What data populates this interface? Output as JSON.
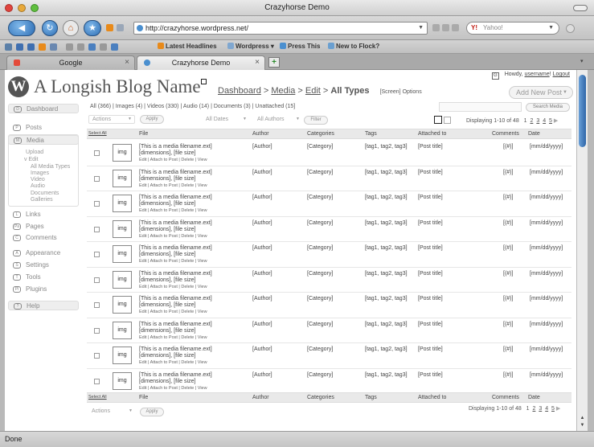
{
  "window": {
    "title": "Crazyhorse Demo"
  },
  "browser": {
    "url": "http://crazyhorse.wordpress.net/",
    "search_engine": "Yahoo!",
    "bookmarks": [
      "Latest Headlines",
      "Wordpress",
      "Press This",
      "New to Flock?"
    ],
    "tabs": [
      {
        "label": "Google",
        "close": "×"
      },
      {
        "label": "Crazyhorse Demo",
        "close": "×"
      }
    ],
    "new_tab": "+",
    "status": "Done",
    "scroll_arrows": "▲ ▼"
  },
  "header": {
    "logo": "W",
    "blog_name": "A Longish Blog Name",
    "crumb_dashboard": "Dashboard",
    "crumb_media": "Media",
    "crumb_edit": "Edit",
    "crumb_current": "All Types",
    "screen_options": "[Screen] Options",
    "howdy_icon": "G",
    "howdy_prefix": "Howdy,",
    "username": "username",
    "howdy_suffix": "!",
    "logout": "Logout",
    "add_new": "Add New Post",
    "add_new_arrow": "▼"
  },
  "sidebar": {
    "items": [
      {
        "icon": "D",
        "label": "Dashboard"
      },
      {
        "icon": "P",
        "label": "Posts"
      },
      {
        "icon": "M",
        "label": "Media"
      },
      {
        "icon": "L",
        "label": "Links"
      },
      {
        "icon": "Pa",
        "label": "Pages"
      },
      {
        "icon": "C",
        "label": "Comments"
      },
      {
        "icon": "A",
        "label": "Appearance"
      },
      {
        "icon": "S",
        "label": "Settings"
      },
      {
        "icon": "T",
        "label": "Tools"
      },
      {
        "icon": "Pl",
        "label": "Plugins"
      },
      {
        "icon": "?",
        "label": "Help"
      }
    ],
    "media_sub": {
      "upload": "Upload",
      "edit": "v Edit",
      "types": [
        "All Media Types",
        "Images",
        "Video",
        "Audio",
        "Documents",
        "Galleries"
      ]
    }
  },
  "toolbar": {
    "filters": "All (366)  |  Images (4)  |  Videos (330)  |  Audio (14)  |  Documents (3)  |  Unattached (15]",
    "search_button": "Search Media",
    "actions": "Actions",
    "apply": "Apply",
    "dates": "All Dates",
    "authors": "All Authors",
    "filter": "Filter",
    "arrow": "▼",
    "displaying": "Displaying 1-10 of 48",
    "pages": [
      "1",
      "2",
      "3",
      "4",
      "5"
    ],
    "next": "▶"
  },
  "table": {
    "columns": {
      "select_all": "Select All",
      "file": "File",
      "author": "Author",
      "categories": "Categories",
      "tags": "Tags",
      "attached": "Attached to",
      "comments": "Comments",
      "date": "Date"
    },
    "rows": [
      {
        "thumb": "img",
        "name": "[This is a media filename.ext]",
        "dims": "[dimensions], [file size]",
        "actions": "Edit | Attach to Post | Delete  | View",
        "author": "[Author]",
        "category": "[Category]",
        "tags": "[tag1, tag2, tag3]",
        "attached": "[Post title]",
        "comments": "[(#)]",
        "date": "[mm/dd/yyyy]"
      },
      {
        "thumb": "img",
        "name": "[This is a media filename.ext]",
        "dims": "[dimensions], [file size]",
        "actions": "Edit | Attach to Post | Delete  | View",
        "author": "[Author]",
        "category": "[Category]",
        "tags": "[tag1, tag2, tag3]",
        "attached": "[Post title]",
        "comments": "[(#)]",
        "date": "[mm/dd/yyyy]"
      },
      {
        "thumb": "img",
        "name": "[This is a media filename.ext]",
        "dims": "[dimensions], [file size]",
        "actions": "Edit | Attach to Post | Delete  | View",
        "author": "[Author]",
        "category": "[Category]",
        "tags": "[tag1, tag2, tag3]",
        "attached": "[Post title]",
        "comments": "[(#)]",
        "date": "[mm/dd/yyyy]"
      },
      {
        "thumb": "img",
        "name": "[This is a media filename.ext]",
        "dims": "[dimensions], [file size]",
        "actions": "Edit | Attach to Post | Delete  | View",
        "author": "[Author]",
        "category": "[Category]",
        "tags": "[tag1, tag2, tag3]",
        "attached": "[Post title]",
        "comments": "[(#)]",
        "date": "[mm/dd/yyyy]"
      },
      {
        "thumb": "img",
        "name": "[This is a media filename.ext]",
        "dims": "[dimensions], [file size]",
        "actions": "Edit | Attach to Post | Delete  | View",
        "author": "[Author]",
        "category": "[Category]",
        "tags": "[tag1, tag2, tag3]",
        "attached": "[Post title]",
        "comments": "[(#)]",
        "date": "[mm/dd/yyyy]"
      },
      {
        "thumb": "img",
        "name": "[This is a media filename.ext]",
        "dims": "[dimensions], [file size]",
        "actions": "Edit | Attach to Post | Delete  | View",
        "author": "[Author]",
        "category": "[Category]",
        "tags": "[tag1, tag2, tag3]",
        "attached": "[Post title]",
        "comments": "[(#)]",
        "date": "[mm/dd/yyyy]"
      },
      {
        "thumb": "img",
        "name": "[This is a media filename.ext]",
        "dims": "[dimensions], [file size]",
        "actions": "Edit | Attach to Post | Delete  | View",
        "author": "[Author]",
        "category": "[Category]",
        "tags": "[tag1, tag2, tag3]",
        "attached": "[Post title]",
        "comments": "[(#)]",
        "date": "[mm/dd/yyyy]"
      },
      {
        "thumb": "img",
        "name": "[This is a media filename.ext]",
        "dims": "[dimensions], [file size]",
        "actions": "Edit | Attach to Post | Delete  | View",
        "author": "[Author]",
        "category": "[Category]",
        "tags": "[tag1, tag2, tag3]",
        "attached": "[Post title]",
        "comments": "[(#)]",
        "date": "[mm/dd/yyyy]"
      },
      {
        "thumb": "img",
        "name": "[This is a media filename.ext]",
        "dims": "[dimensions], [file size]",
        "actions": "Edit | Attach to Post | Delete  | View",
        "author": "[Author]",
        "category": "[Category]",
        "tags": "[tag1, tag2, tag3]",
        "attached": "[Post title]",
        "comments": "[(#)]",
        "date": "[mm/dd/yyyy]"
      },
      {
        "thumb": "img",
        "name": "[This is a media filename.ext]",
        "dims": "[dimensions], [file size]",
        "actions": "Edit | Attach to Post | Delete  | View",
        "author": "[Author]",
        "category": "[Category]",
        "tags": "[tag1, tag2, tag3]",
        "attached": "[Post title]",
        "comments": "[(#)]",
        "date": "[mm/dd/yyyy]"
      }
    ]
  }
}
